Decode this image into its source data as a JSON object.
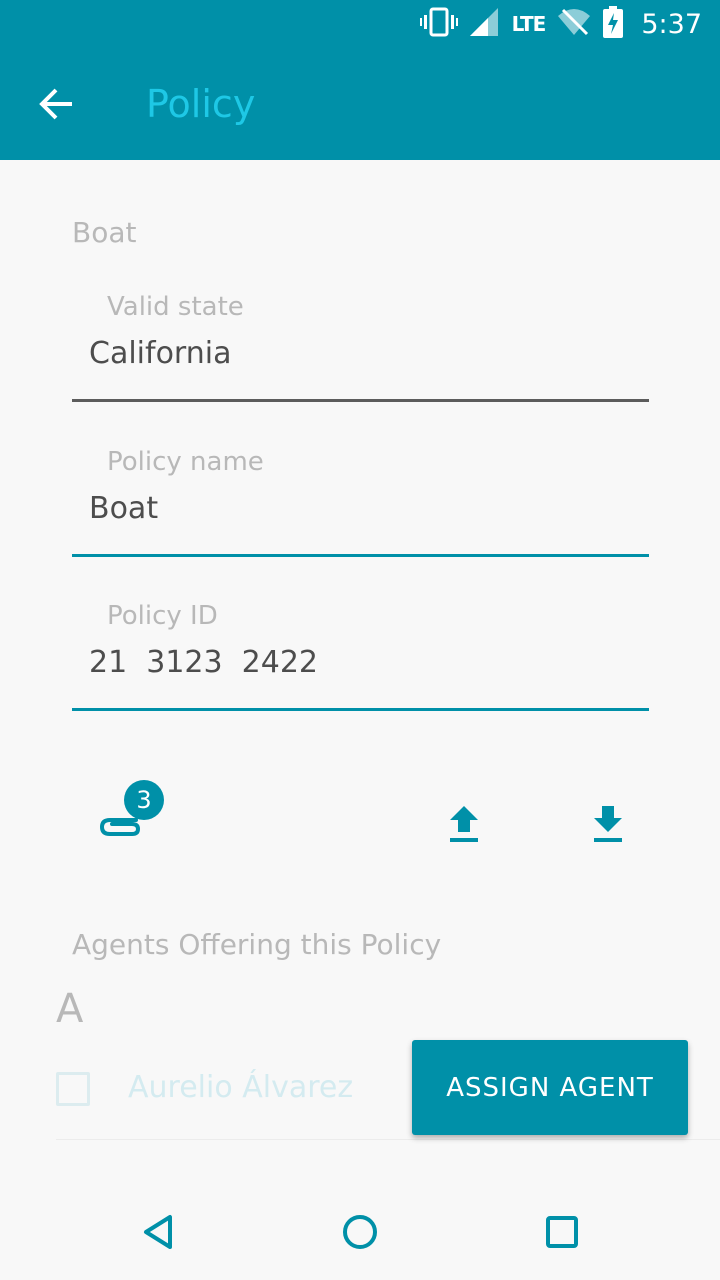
{
  "status_bar": {
    "time": "5:37",
    "network_label": "LTE",
    "icons": [
      "vibrate-icon",
      "signal-icon",
      "wifi-off-icon",
      "battery-charging-icon"
    ]
  },
  "app_bar": {
    "title": "Policy",
    "back_icon": "arrow-back-icon"
  },
  "policy": {
    "section_title": "Boat",
    "fields": [
      {
        "label": "Valid state",
        "value": "California"
      },
      {
        "label": "Policy name",
        "value": "Boat"
      },
      {
        "label": "Policy ID",
        "value": "21  3123  2422"
      }
    ]
  },
  "actions": {
    "attachment_count": "3",
    "icons": [
      "attachment-icon",
      "upload-icon",
      "download-icon"
    ]
  },
  "agents": {
    "title": "Agents Offering this Policy",
    "index_letter": "A",
    "items": [
      {
        "name": "Aurelio Álvarez",
        "checked": false
      }
    ],
    "assign_button_label": "ASSIGN AGENT"
  },
  "nav_bar": {
    "icons": [
      "back-triangle-icon",
      "home-circle-icon",
      "recents-square-icon"
    ]
  },
  "colors": {
    "primary": "#0090a8",
    "title_accent": "#1ec8e6",
    "background": "#f8f8f8"
  }
}
